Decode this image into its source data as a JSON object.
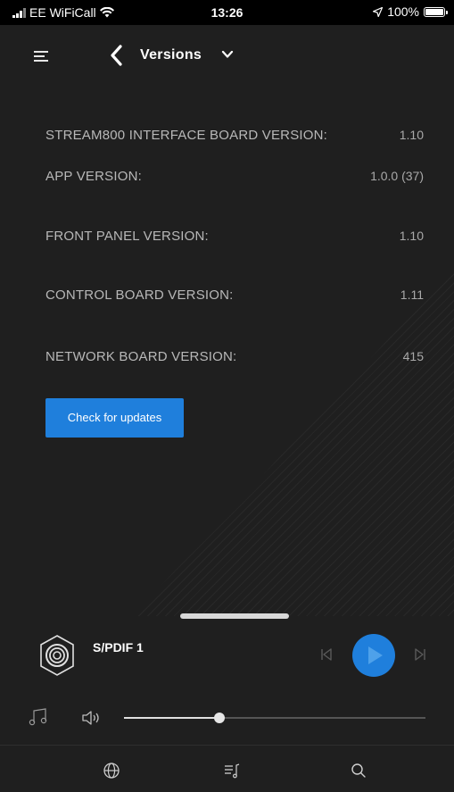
{
  "status_bar": {
    "carrier": "EE WiFiCall",
    "time": "13:26",
    "battery_text": "100%"
  },
  "header": {
    "title": "Versions",
    "icons": [
      "menu-icon",
      "back-chevron-icon",
      "chevron-down-icon"
    ]
  },
  "versions": [
    {
      "label": "STREAM800 INTERFACE BOARD VERSION:",
      "value": "1.10"
    },
    {
      "label": "APP VERSION:",
      "value": "1.0.0 (37)"
    },
    {
      "label": "FRONT PANEL VERSION:",
      "value": "1.10"
    },
    {
      "label": "CONTROL BOARD VERSION:",
      "value": "1.11"
    },
    {
      "label": "NETWORK BOARD VERSION:",
      "value": "415"
    }
  ],
  "update_button": {
    "label": "Check for updates"
  },
  "player": {
    "source_label": "S/PDIF 1",
    "volume_fraction": 0.318,
    "icons": [
      "source-icon",
      "previous-track-icon",
      "play-icon",
      "next-track-icon",
      "music-icon",
      "volume-icon"
    ]
  },
  "tab_bar": {
    "icons": [
      "globe-icon",
      "queue-icon",
      "search-icon"
    ]
  },
  "colors": {
    "background": "#1f1f1f",
    "accent": "#1f7fdc",
    "text_secondary": "#b8b8b8"
  }
}
